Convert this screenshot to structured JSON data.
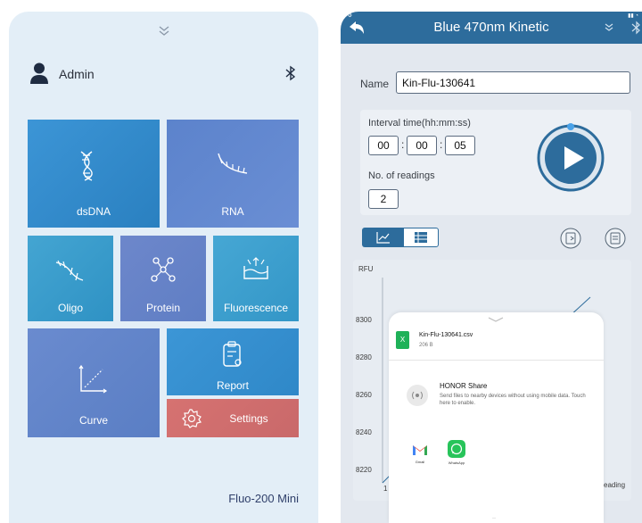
{
  "left_panel": {
    "user": {
      "name": "Admin"
    },
    "tiles": {
      "dsdna": "dsDNA",
      "rna": "RNA",
      "oligo": "Oligo",
      "protein": "Protein",
      "fluorescence": "Fluorescence",
      "curve": "Curve",
      "report": "Report",
      "settings": "Settings"
    },
    "model": "Fluo-200 Mini",
    "colors": {
      "tile_blue": "#3a8fd0",
      "tile_purple": "#6786c9",
      "tile_teal": "#3ea0cc",
      "settings": "#cf6e6d"
    }
  },
  "right_panel": {
    "header": {
      "title": "Blue 470nm Kinetic"
    },
    "name_label": "Name",
    "name_value": "Kin-Flu-130641",
    "interval_label": "Interval time(hh:mm:ss)",
    "interval": {
      "hh": "00",
      "mm": "00",
      "ss": "05"
    },
    "readings_label": "No. of readings",
    "readings_value": "2",
    "chart": {
      "ylabel": "RFU",
      "y_ticks": [
        "8300",
        "8280",
        "8260",
        "8240",
        "8220"
      ],
      "x_first_tick": "1",
      "x_label_fragment": "eading"
    }
  },
  "share_sheet": {
    "file_name": "Kin-Flu-130641.csv",
    "file_size": "206 B",
    "file_icon_letter": "X",
    "honor_share_title": "HONOR Share",
    "honor_share_desc": "Send files to nearby devices without using mobile data. Touch here to enable.",
    "apps": [
      {
        "label": "Gmail"
      },
      {
        "label": "WhatsApp"
      }
    ]
  }
}
